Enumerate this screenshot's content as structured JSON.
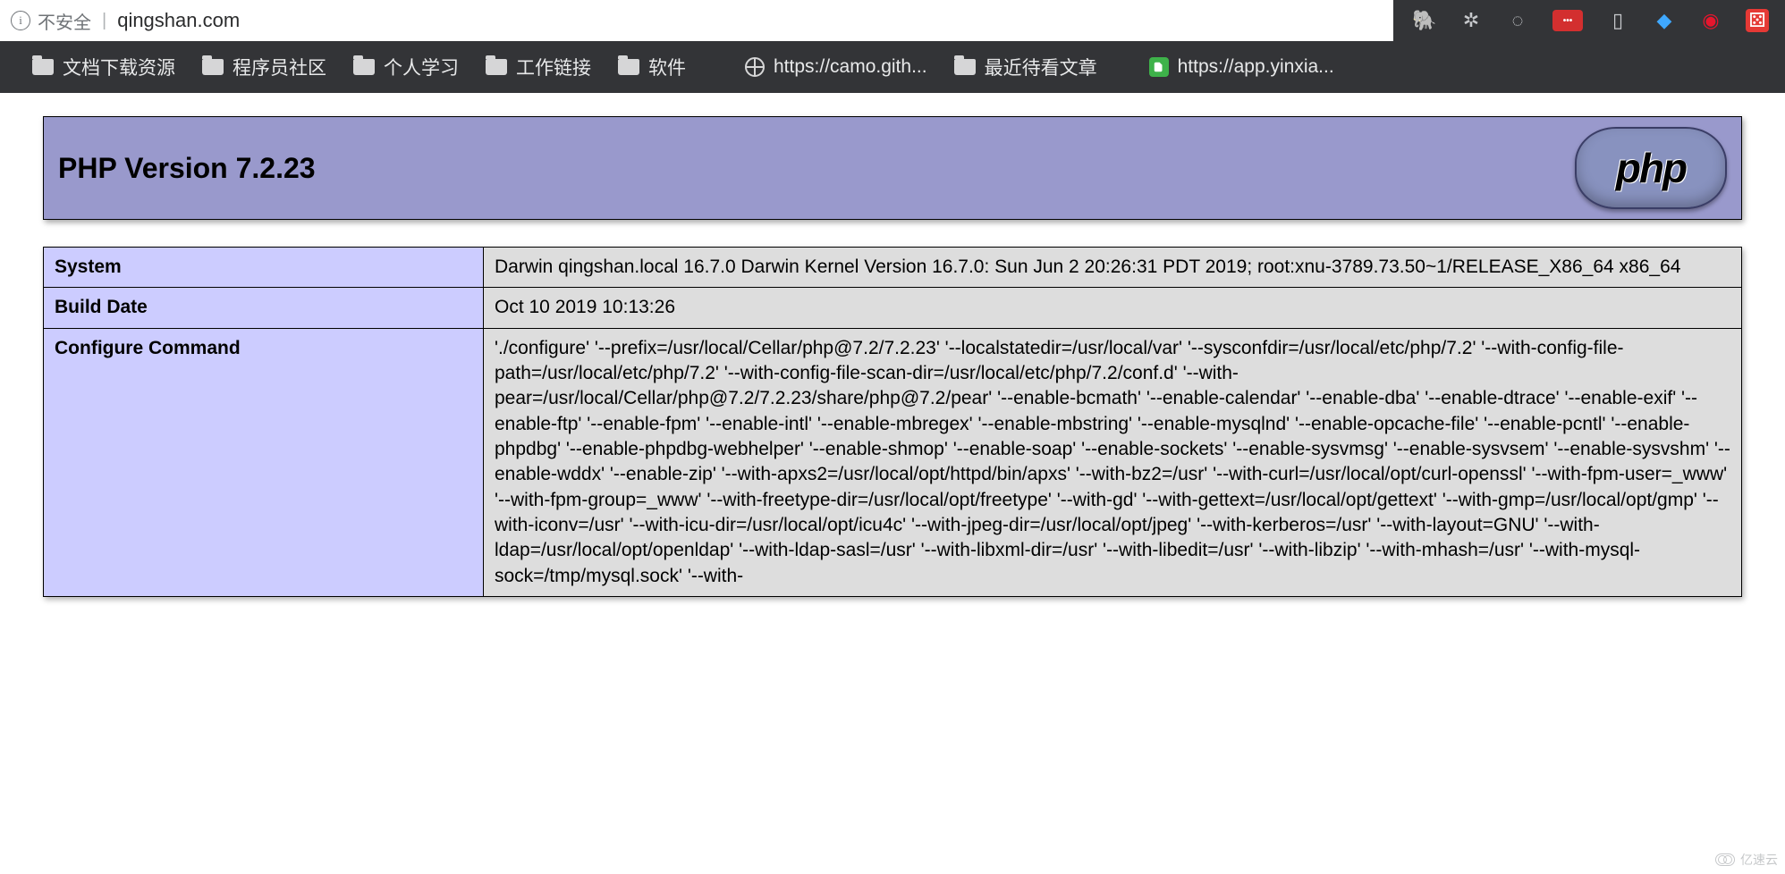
{
  "browser": {
    "not_secure_label": "不安全",
    "url": "qingshan.com",
    "bookmarks": [
      {
        "icon": "folder",
        "label": "文档下载资源"
      },
      {
        "icon": "folder",
        "label": "程序员社区"
      },
      {
        "icon": "folder",
        "label": "个人学习"
      },
      {
        "icon": "folder",
        "label": "工作链接"
      },
      {
        "icon": "folder",
        "label": "软件"
      },
      {
        "icon": "globe",
        "label": "https://camo.gith..."
      },
      {
        "icon": "folder",
        "label": "最近待看文章"
      },
      {
        "icon": "evernote",
        "label": "https://app.yinxia..."
      }
    ],
    "extensions": [
      {
        "name": "evernote-icon",
        "glyph": "🐘",
        "cls": "ext-green"
      },
      {
        "name": "gear-icon",
        "glyph": "✲",
        "cls": ""
      },
      {
        "name": "refresh-icon",
        "glyph": "◌",
        "cls": ""
      },
      {
        "name": "lastpass-icon",
        "glyph": "•••",
        "cls": "ext-lp"
      },
      {
        "name": "bookmark-outline-icon",
        "glyph": "▯",
        "cls": ""
      },
      {
        "name": "diamond-icon",
        "glyph": "◆",
        "cls": "ext-blue"
      },
      {
        "name": "weibo-icon",
        "glyph": "◉",
        "cls": "ext-weibo"
      },
      {
        "name": "dice-icon",
        "glyph": "⚄",
        "cls": "ext-dice"
      }
    ]
  },
  "php": {
    "title": "PHP Version 7.2.23",
    "logo_text": "php",
    "rows": [
      {
        "key": "System",
        "val": "Darwin qingshan.local 16.7.0 Darwin Kernel Version 16.7.0: Sun Jun 2 20:26:31 PDT 2019; root:xnu-3789.73.50~1/RELEASE_X86_64 x86_64"
      },
      {
        "key": "Build Date",
        "val": "Oct 10 2019 10:13:26"
      },
      {
        "key": "Configure Command",
        "val": "'./configure' '--prefix=/usr/local/Cellar/php@7.2/7.2.23' '--localstatedir=/usr/local/var' '--sysconfdir=/usr/local/etc/php/7.2' '--with-config-file-path=/usr/local/etc/php/7.2' '--with-config-file-scan-dir=/usr/local/etc/php/7.2/conf.d' '--with-pear=/usr/local/Cellar/php@7.2/7.2.23/share/php@7.2/pear' '--enable-bcmath' '--enable-calendar' '--enable-dba' '--enable-dtrace' '--enable-exif' '--enable-ftp' '--enable-fpm' '--enable-intl' '--enable-mbregex' '--enable-mbstring' '--enable-mysqlnd' '--enable-opcache-file' '--enable-pcntl' '--enable-phpdbg' '--enable-phpdbg-webhelper' '--enable-shmop' '--enable-soap' '--enable-sockets' '--enable-sysvmsg' '--enable-sysvsem' '--enable-sysvshm' '--enable-wddx' '--enable-zip' '--with-apxs2=/usr/local/opt/httpd/bin/apxs' '--with-bz2=/usr' '--with-curl=/usr/local/opt/curl-openssl' '--with-fpm-user=_www' '--with-fpm-group=_www' '--with-freetype-dir=/usr/local/opt/freetype' '--with-gd' '--with-gettext=/usr/local/opt/gettext' '--with-gmp=/usr/local/opt/gmp' '--with-iconv=/usr' '--with-icu-dir=/usr/local/opt/icu4c' '--with-jpeg-dir=/usr/local/opt/jpeg' '--with-kerberos=/usr' '--with-layout=GNU' '--with-ldap=/usr/local/opt/openldap' '--with-ldap-sasl=/usr' '--with-libxml-dir=/usr' '--with-libedit=/usr' '--with-libzip' '--with-mhash=/usr' '--with-mysql-sock=/tmp/mysql.sock' '--with-"
      }
    ]
  },
  "watermark": "亿速云"
}
